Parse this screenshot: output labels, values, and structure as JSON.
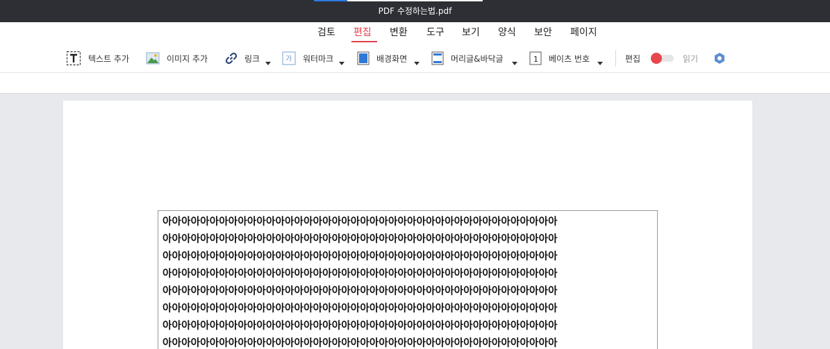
{
  "window": {
    "title": "PDF 수정하는법.pdf"
  },
  "menu": {
    "items": [
      "검토",
      "편집",
      "변환",
      "도구",
      "보기",
      "양식",
      "보안",
      "페이지"
    ],
    "active": "편집"
  },
  "toolbar": {
    "add_text": "텍스트 추가",
    "add_image": "이미지 추가",
    "link": "링크",
    "watermark": "워터마크",
    "background": "배경화면",
    "header_footer": "머리글&바닥글",
    "bates_number": "베이츠 번호",
    "edit_mode": "편집",
    "read_mode": "읽기",
    "edit_toggle_on": true
  },
  "document": {
    "text_lines": [
      "아아아아아아아아아아아아아아아아아아아아아아아아아아아아아아아아아아아아아아아아아아",
      "아아아아아아아아아아아아아아아아아아아아아아아아아아아아아아아아아아아아아아아아아아",
      "아아아아아아아아아아아아아아아아아아아아아아아아아아아아아아아아아아아아아아아아아아",
      "아아아아아아아아아아아아아아아아아아아아아아아아아아아아아아아아아아아아아아아아아아",
      "아아아아아아아아아아아아아아아아아아아아아아아아아아아아아아아아아아아아아아아아아아",
      "아아아아아아아아아아아아아아아아아아아아아아아아아아아아아아아아아아아아아아아아아아",
      "아아아아아아아아아아아아아아아아아아아아아아아아아아아아아아아아아아아아아아아아아아",
      "아아아아아아아아아아아아아아아아아아아아아아아아아아아아아아아아아아아아아아아아아아"
    ]
  },
  "colors": {
    "accent": "#e0404a",
    "titlebar": "#2e2f34",
    "canvas": "#e8e9ec"
  }
}
